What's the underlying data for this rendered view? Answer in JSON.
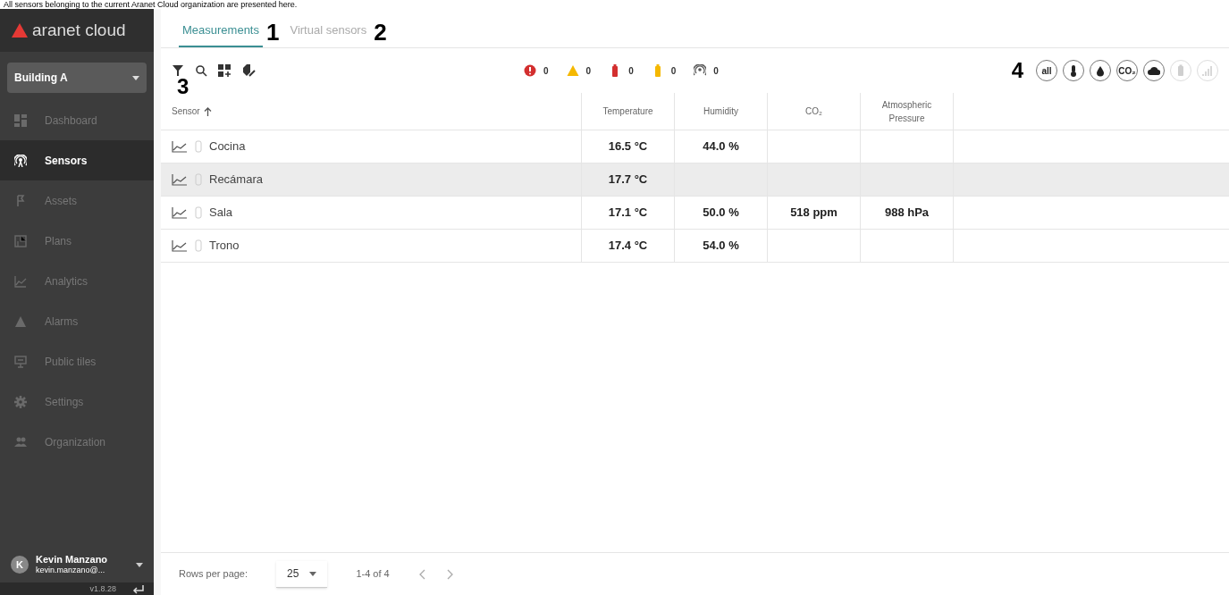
{
  "caption": "All sensors belonging to the current Aranet Cloud organization are presented here.",
  "sidebar": {
    "logo": "aranet cloud",
    "building": "Building A",
    "items": [
      {
        "label": "Dashboard",
        "kind": "dashboard",
        "selected": false
      },
      {
        "label": "Sensors",
        "kind": "sensors",
        "selected": true
      },
      {
        "label": "Assets",
        "kind": "assets",
        "selected": false
      },
      {
        "label": "Plans",
        "kind": "plans",
        "selected": false
      },
      {
        "label": "Analytics",
        "kind": "analytics",
        "selected": false
      },
      {
        "label": "Alarms",
        "kind": "alarms",
        "selected": false
      },
      {
        "label": "Public tiles",
        "kind": "tiles",
        "selected": false
      },
      {
        "label": "Settings",
        "kind": "settings",
        "selected": false
      },
      {
        "label": "Organization",
        "kind": "organization",
        "selected": false
      }
    ],
    "user": {
      "initial": "K",
      "name": "Kevin Manzano",
      "email": "kevin.manzano@..."
    },
    "version": "v1.8.28"
  },
  "tabs": [
    {
      "label": "Measurements",
      "selected": true
    },
    {
      "label": "Virtual sensors",
      "selected": false
    }
  ],
  "callouts": [
    "1",
    "2",
    "3",
    "4"
  ],
  "status_counts": [
    {
      "kind": "alert",
      "color": "#d32f2f",
      "count": "0"
    },
    {
      "kind": "warning",
      "color": "#f5b800",
      "count": "0"
    },
    {
      "kind": "battery",
      "color": "#d32f2f",
      "count": "0"
    },
    {
      "kind": "battery",
      "color": "#f5b800",
      "count": "0"
    },
    {
      "kind": "signal",
      "color": "#555555",
      "count": "0"
    }
  ],
  "filters": [
    {
      "kind": "text",
      "label": "all",
      "disabled": false
    },
    {
      "kind": "thermometer",
      "disabled": false
    },
    {
      "kind": "drop",
      "disabled": false
    },
    {
      "kind": "text",
      "label": "CO₂",
      "disabled": false
    },
    {
      "kind": "cloud",
      "disabled": false
    },
    {
      "kind": "battery",
      "disabled": true
    },
    {
      "kind": "signal",
      "disabled": true
    }
  ],
  "table": {
    "columns": [
      "Sensor",
      "Temperature",
      "Humidity",
      "CO₂",
      "Atmospheric Pressure"
    ],
    "rows": [
      {
        "name": "Cocina",
        "selected": false,
        "temperature": "16.5 °C",
        "humidity": "44.0 %"
      },
      {
        "name": "Recámara",
        "selected": true,
        "temperature": "17.7 °C"
      },
      {
        "name": "Sala",
        "selected": false,
        "temperature": "17.1 °C",
        "humidity": "50.0 %",
        "co2": "518 ppm",
        "pressure": "988 hPa"
      },
      {
        "name": "Trono",
        "selected": false,
        "temperature": "17.4 °C",
        "humidity": "54.0 %"
      }
    ]
  },
  "pagination": {
    "label": "Rows per page:",
    "rows_per_page": "25",
    "range": "1-4 of 4"
  }
}
